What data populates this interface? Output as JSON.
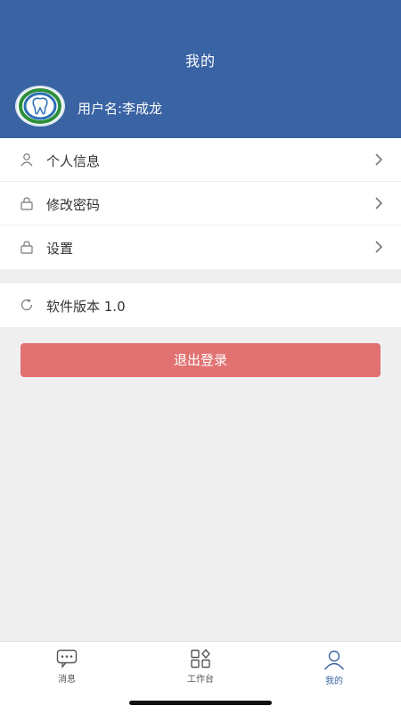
{
  "header": {
    "title": "我的",
    "username": "用户名:李成龙"
  },
  "menu": {
    "items": [
      {
        "label": "个人信息",
        "icon": "user-icon"
      },
      {
        "label": "修改密码",
        "icon": "lock-icon"
      },
      {
        "label": "设置",
        "icon": "lock-icon"
      }
    ]
  },
  "version": {
    "label": "软件版本 1.0",
    "icon": "refresh-icon"
  },
  "logout": {
    "label": "退出登录"
  },
  "tabbar": {
    "tabs": [
      {
        "label": "消息",
        "icon": "message-icon"
      },
      {
        "label": "工作台",
        "icon": "grid-icon"
      },
      {
        "label": "我的",
        "icon": "user-icon",
        "active": true
      }
    ]
  },
  "colors": {
    "header": "#3a63a3",
    "logout": "#e27171",
    "background": "#efefef"
  }
}
